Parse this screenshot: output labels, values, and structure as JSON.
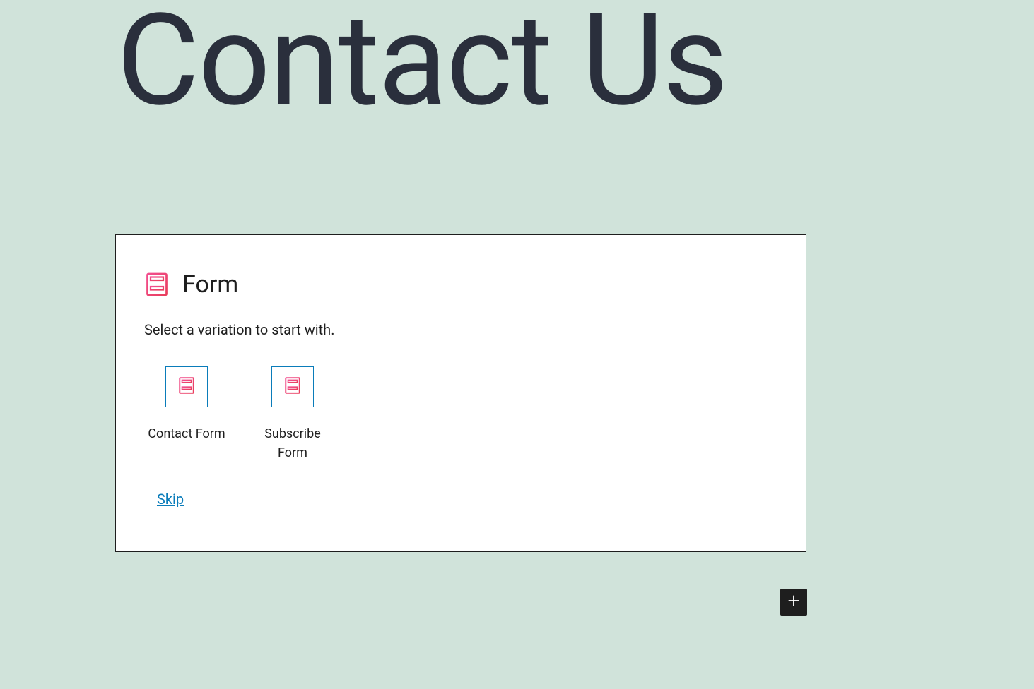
{
  "page": {
    "title": "Contact Us"
  },
  "block": {
    "title": "Form",
    "description": "Select a variation to start with.",
    "variations": [
      {
        "label": "Contact Form"
      },
      {
        "label": "Subscribe Form"
      }
    ],
    "skip_label": "Skip"
  }
}
